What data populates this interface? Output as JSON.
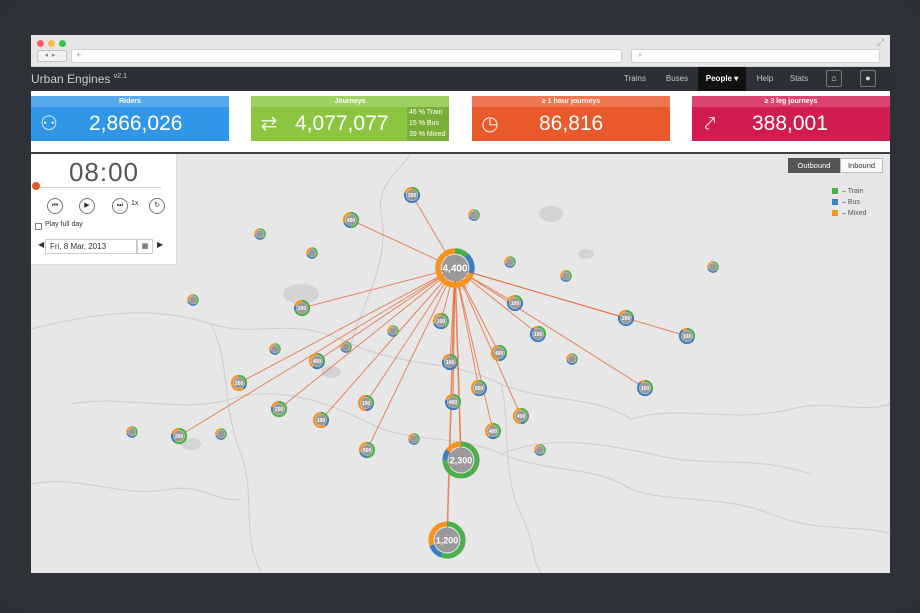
{
  "app": {
    "name": "Urban Engines",
    "version": "v2.1"
  },
  "nav": {
    "items": [
      "Trains",
      "Buses",
      "People ▾",
      "Help",
      "Stats"
    ]
  },
  "stats": {
    "riders": {
      "label": "Riders",
      "value": "2,866,026",
      "color": "#3196e8"
    },
    "journeys": {
      "label": "Journeys",
      "value": "4,077,077",
      "color": "#8cc640",
      "breakdown": [
        "46 % Train",
        "15 % Bus",
        "39 % Mixed"
      ]
    },
    "hour": {
      "label": "≥ 1 hour journeys",
      "value": "86,816",
      "color": "#e85a2c"
    },
    "legs": {
      "label": "≥ 3 leg journeys",
      "value": "388,001",
      "color": "#d21c50"
    }
  },
  "time": {
    "clock": "08:00",
    "speed": "1x",
    "play_full_day": "Play full day",
    "date": "Fri, 8 Mar, 2013"
  },
  "map": {
    "toggle": {
      "outbound": "Outbound",
      "inbound": "Inbound",
      "selected": "Outbound"
    },
    "legend": [
      {
        "label": "– Train",
        "color": "#4ab04a"
      },
      {
        "label": "– Bus",
        "color": "#3f7fbf"
      },
      {
        "label": "– Mixed",
        "color": "#f7931e"
      }
    ],
    "hub": {
      "label": "4,400"
    },
    "nodes": [
      "300",
      "400",
      "200",
      "100",
      "100",
      "400",
      "100",
      "200",
      "100",
      "400",
      "200",
      "400",
      "500",
      "100",
      "400",
      "200",
      "100",
      "100",
      "200",
      "500",
      "400",
      "100",
      "2,300",
      "1,200"
    ]
  }
}
